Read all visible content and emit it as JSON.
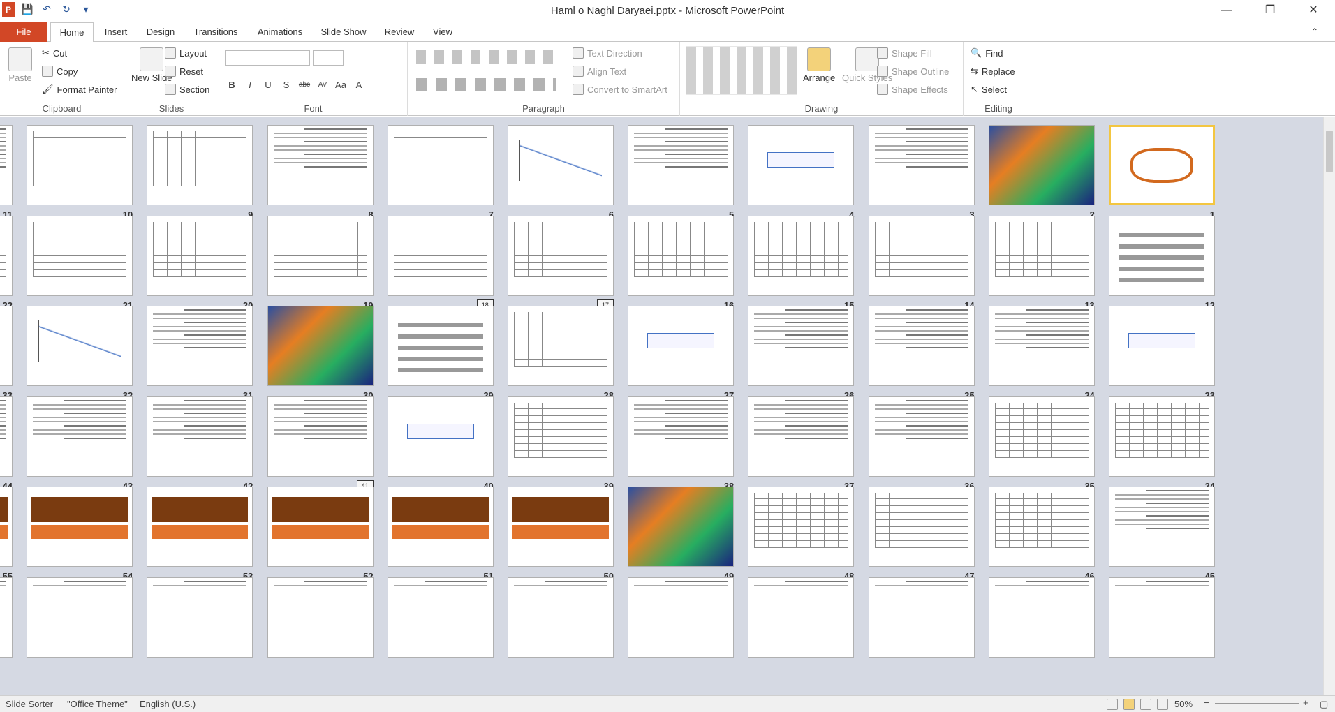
{
  "window": {
    "title": "Haml o Naghl Daryaei.pptx - Microsoft PowerPoint",
    "app_icon": "P"
  },
  "qat": [
    "save-icon",
    "undo-icon",
    "redo-icon",
    "customize-icon"
  ],
  "tabs": [
    "File",
    "Home",
    "Insert",
    "Design",
    "Transitions",
    "Animations",
    "Slide Show",
    "Review",
    "View"
  ],
  "ribbon": {
    "clipboard": {
      "label": "Clipboard",
      "paste": "Paste",
      "cut": "Cut",
      "copy": "Copy",
      "format_painter": "Format Painter"
    },
    "slides": {
      "label": "Slides",
      "new_slide": "New Slide",
      "layout": "Layout",
      "reset": "Reset",
      "section": "Section"
    },
    "font": {
      "label": "Font",
      "bold": "B",
      "italic": "I",
      "underline": "U",
      "shadow": "S",
      "strike": "abc",
      "spacing": "AV",
      "case": "Aa",
      "color": "A"
    },
    "paragraph": {
      "label": "Paragraph",
      "text_direction": "Text Direction",
      "align_text": "Align Text",
      "convert_smartart": "Convert to SmartArt"
    },
    "drawing": {
      "label": "Drawing",
      "arrange": "Arrange",
      "quick_styles": "Quick Styles",
      "shape_fill": "Shape Fill",
      "shape_outline": "Shape Outline",
      "shape_effects": "Shape Effects"
    },
    "editing": {
      "label": "Editing",
      "find": "Find",
      "replace": "Replace",
      "select": "Select"
    }
  },
  "slides": [
    {
      "n": "1",
      "type": "logo",
      "selected": true
    },
    {
      "n": "2",
      "type": "photo"
    },
    {
      "n": "3",
      "type": "text"
    },
    {
      "n": "4",
      "type": "title"
    },
    {
      "n": "5",
      "type": "text"
    },
    {
      "n": "6",
      "type": "chart"
    },
    {
      "n": "7",
      "type": "table"
    },
    {
      "n": "8",
      "type": "text"
    },
    {
      "n": "9",
      "type": "table"
    },
    {
      "n": "10",
      "type": "table"
    },
    {
      "n": "11",
      "type": "text"
    },
    {
      "n": "12",
      "type": "diagram"
    },
    {
      "n": "13",
      "type": "table"
    },
    {
      "n": "14",
      "type": "table"
    },
    {
      "n": "15",
      "type": "table"
    },
    {
      "n": "16",
      "type": "table"
    },
    {
      "n": "17",
      "type": "table",
      "hidden": true
    },
    {
      "n": "18",
      "type": "table",
      "hidden": true
    },
    {
      "n": "19",
      "type": "table"
    },
    {
      "n": "20",
      "type": "table"
    },
    {
      "n": "21",
      "type": "table"
    },
    {
      "n": "22",
      "type": "table"
    },
    {
      "n": "23",
      "type": "title"
    },
    {
      "n": "24",
      "type": "text"
    },
    {
      "n": "25",
      "type": "text"
    },
    {
      "n": "26",
      "type": "text"
    },
    {
      "n": "27",
      "type": "title"
    },
    {
      "n": "28",
      "type": "table"
    },
    {
      "n": "29",
      "type": "diagram"
    },
    {
      "n": "30",
      "type": "photo"
    },
    {
      "n": "31",
      "type": "text"
    },
    {
      "n": "32",
      "type": "chart"
    },
    {
      "n": "33",
      "type": "title"
    },
    {
      "n": "34",
      "type": "table"
    },
    {
      "n": "35",
      "type": "table"
    },
    {
      "n": "36",
      "type": "text"
    },
    {
      "n": "37",
      "type": "text"
    },
    {
      "n": "38",
      "type": "text"
    },
    {
      "n": "39",
      "type": "table"
    },
    {
      "n": "40",
      "type": "title"
    },
    {
      "n": "41",
      "type": "text",
      "hidden": true
    },
    {
      "n": "42",
      "type": "text"
    },
    {
      "n": "43",
      "type": "text"
    },
    {
      "n": "44",
      "type": "text"
    },
    {
      "n": "45",
      "type": "text"
    },
    {
      "n": "46",
      "type": "table"
    },
    {
      "n": "47",
      "type": "table"
    },
    {
      "n": "48",
      "type": "table"
    },
    {
      "n": "49",
      "type": "photo"
    },
    {
      "n": "50",
      "type": "brown"
    },
    {
      "n": "51",
      "type": "brown"
    },
    {
      "n": "52",
      "type": "brown"
    },
    {
      "n": "53",
      "type": "brown"
    },
    {
      "n": "54",
      "type": "brown"
    },
    {
      "n": "55",
      "type": "brown"
    }
  ],
  "status": {
    "view": "Slide Sorter",
    "theme": "\"Office Theme\"",
    "language": "English (U.S.)",
    "zoom": "50%"
  }
}
